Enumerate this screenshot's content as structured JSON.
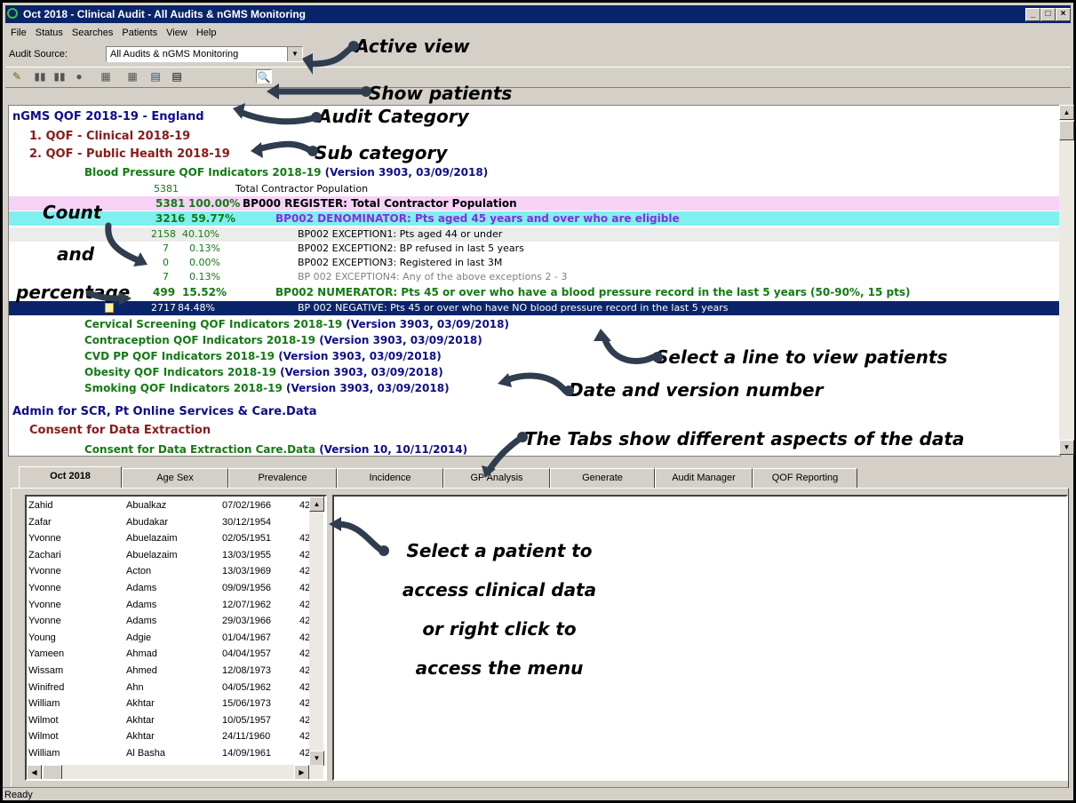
{
  "window": {
    "title": "Oct 2018 - Clinical Audit - All Audits & nGMS Monitoring",
    "min": "_",
    "max": "□",
    "close": "×"
  },
  "menu": [
    "File",
    "Status",
    "Searches",
    "Patients",
    "View",
    "Help"
  ],
  "audit_source": {
    "label": "Audit Source:",
    "value": "All Audits & nGMS Monitoring",
    "arrow": "▼"
  },
  "toolbar": [
    {
      "name": "edit-icon",
      "glyph": "✎"
    },
    {
      "name": "bars-icon-1",
      "glyph": "▮▮"
    },
    {
      "name": "bars-icon-2",
      "glyph": "▮▮"
    },
    {
      "name": "circle-icon",
      "glyph": "●"
    },
    {
      "name": "grid-icon-1",
      "glyph": "▦"
    },
    {
      "name": "grid-icon-2",
      "glyph": "▦"
    },
    {
      "name": "chart-icon",
      "glyph": "▤"
    },
    {
      "name": "list-icon",
      "glyph": "▤"
    },
    {
      "name": "magnifier-icon",
      "glyph": "🔍"
    }
  ],
  "tree": {
    "top": "nGMS QOF 2018-19 - England",
    "sub1": "1. QOF - Clinical 2018-19",
    "sub2": "2. QOF - Public Health 2018-19",
    "bp": {
      "name": "Blood Pressure QOF Indicators 2018-19",
      "version": "(Version 3903, 03/09/2018)"
    },
    "lines": [
      {
        "count": "5381",
        "pct": "",
        "text": "Total Contractor Population"
      },
      {
        "count": "5381",
        "pct": "100.00%",
        "text": "BP000 REGISTER: Total Contractor Population"
      },
      {
        "count": "3216",
        "pct": "59.77%",
        "text": "BP002 DENOMINATOR: Pts aged 45 years and over who are eligible"
      },
      {
        "count": "2158",
        "pct": "40.10%",
        "text": "BP002 EXCEPTION1: Pts aged 44 or under"
      },
      {
        "count": "7",
        "pct": "0.13%",
        "text": "BP002 EXCEPTION2: BP refused in last 5 years"
      },
      {
        "count": "0",
        "pct": "0.00%",
        "text": "BP002 EXCEPTION3: Registered in last 3M"
      },
      {
        "count": "7",
        "pct": "0.13%",
        "text": "BP 002 EXCEPTION4: Any of the above exceptions 2 - 3"
      },
      {
        "count": "499",
        "pct": "15.52%",
        "text": "BP002 NUMERATOR: Pts 45 or over who have a blood pressure record in the last 5 years (50-90%, 15 pts)"
      },
      {
        "count": "2717",
        "pct": "84.48%",
        "text": "BP 002 NEGATIVE: Pts 45 or over who have NO blood pressure record in the last 5 years"
      }
    ],
    "others": [
      {
        "name": "Cervical Screening QOF Indicators 2018-19",
        "version": "(Version 3903, 03/09/2018)"
      },
      {
        "name": "Contraception QOF Indicators 2018-19",
        "version": "(Version 3903, 03/09/2018)"
      },
      {
        "name": "CVD PP QOF Indicators 2018-19",
        "version": "(Version 3903, 03/09/2018)"
      },
      {
        "name": "Obesity QOF Indicators 2018-19",
        "version": "(Version 3903, 03/09/2018)"
      },
      {
        "name": "Smoking QOF Indicators 2018-19",
        "version": "(Version 3903, 03/09/2018)"
      }
    ],
    "admin": "Admin for SCR, Pt Online Services & Care.Data",
    "consent": "Consent for Data Extraction",
    "consent_item": {
      "name": "Consent for Data Extraction Care.Data",
      "version": "(Version 10, 10/11/2014)"
    }
  },
  "tabs": [
    "Oct 2018",
    "Age Sex",
    "Prevalence",
    "Incidence",
    "GP Analysis",
    "Generate",
    "Audit Manager",
    "QOF Reporting"
  ],
  "patients": [
    [
      "Zahid",
      "Abualkaz",
      "07/02/1966",
      "42"
    ],
    [
      "Zafar",
      "Abudakar",
      "30/12/1954",
      ""
    ],
    [
      "Yvonne",
      "Abuelazaim",
      "02/05/1951",
      "42"
    ],
    [
      "Zachari",
      "Abuelazaim",
      "13/03/1955",
      "42"
    ],
    [
      "Yvonne",
      "Acton",
      "13/03/1969",
      "42"
    ],
    [
      "Yvonne",
      "Adams",
      "09/09/1956",
      "42"
    ],
    [
      "Yvonne",
      "Adams",
      "12/07/1962",
      "42"
    ],
    [
      "Yvonne",
      "Adams",
      "29/03/1966",
      "42"
    ],
    [
      "Young",
      "Adgie",
      "01/04/1967",
      "42"
    ],
    [
      "Yameen",
      "Ahmad",
      "04/04/1957",
      "42"
    ],
    [
      "Wissam",
      "Ahmed",
      "12/08/1973",
      "42"
    ],
    [
      "Winifred",
      "Ahn",
      "04/05/1962",
      "42"
    ],
    [
      "William",
      "Akhtar",
      "15/06/1973",
      "42"
    ],
    [
      "Wilmot",
      "Akhtar",
      "10/05/1957",
      "42"
    ],
    [
      "Wilmot",
      "Akhtar",
      "24/11/1960",
      "42"
    ],
    [
      "William",
      "Al Basha",
      "14/09/1961",
      "42"
    ]
  ],
  "status": "Ready",
  "annotations": {
    "active_view": "Active view",
    "show_patients": "Show patients",
    "audit_category": "Audit Category",
    "sub_category": "Sub category",
    "count": "Count",
    "and": "and",
    "percentage": "percentage",
    "select_line": "Select a line to view patients",
    "date_version": "Date and version number",
    "tabs_note": "The Tabs show different aspects of the data",
    "select_patient": [
      "Select a patient to",
      "access clinical data",
      "or right click to",
      "access the menu"
    ]
  }
}
